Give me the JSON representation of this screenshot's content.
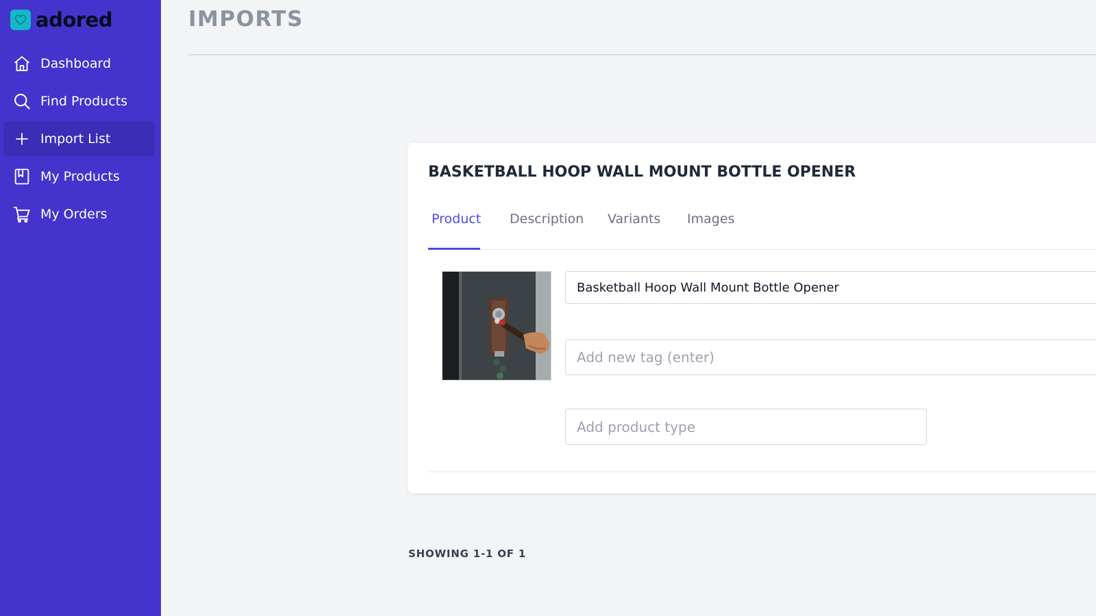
{
  "app": {
    "brand": "adored"
  },
  "sidebar": {
    "items": [
      {
        "label": "Dashboard",
        "icon": "home-icon"
      },
      {
        "label": "Find Products",
        "icon": "search-icon"
      },
      {
        "label": "Import List",
        "icon": "plus-icon",
        "active": true
      },
      {
        "label": "My Products",
        "icon": "book-icon"
      },
      {
        "label": "My Orders",
        "icon": "cart-icon"
      }
    ]
  },
  "header": {
    "title": "IMPORTS"
  },
  "product": {
    "heading": "BASKETBALL HOOP WALL MOUNT BOTTLE OPENER",
    "tabs": [
      {
        "label": "Product",
        "active": true
      },
      {
        "label": "Description"
      },
      {
        "label": "Variants"
      },
      {
        "label": "Images"
      }
    ],
    "image_alt": "Basketball Hoop Wall Mount Bottle Opener",
    "title_value": "Basketball Hoop Wall Mount Bottle Opener",
    "tags_placeholder": "Add new tag (enter)",
    "type_placeholder": "Add product type"
  },
  "pagination": {
    "summary": "SHOWING 1-1 OF 1"
  },
  "colors": {
    "sidebar_bg": "#4433cc",
    "active_item_bg": "#3b2db5",
    "accent": "#4f46e5",
    "logo_mark": "#14b8c8"
  }
}
